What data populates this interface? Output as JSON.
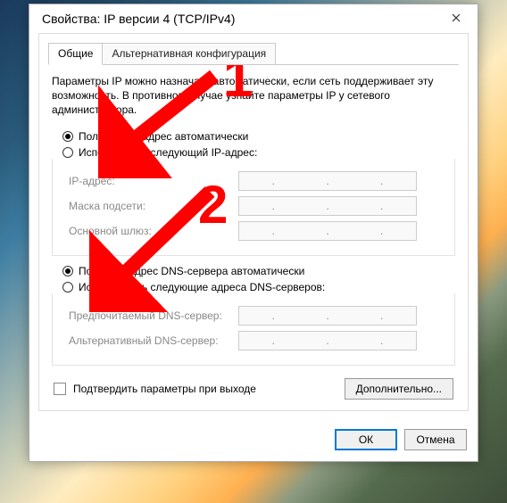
{
  "window": {
    "title": "Свойства: IP версии 4 (TCP/IPv4)"
  },
  "tabs": {
    "general": "Общие",
    "alt": "Альтернативная конфигурация"
  },
  "intro": "Параметры IP можно назначать автоматически, если сеть поддерживает эту возможность. В противном случае узнайте параметры IP у сетевого администратора.",
  "ip": {
    "auto_label": "Получить IP-адрес автоматически",
    "manual_label": "Использовать следующий IP-адрес:",
    "addr_label": "IP-адрес:",
    "mask_label": "Маска подсети:",
    "gw_label": "Основной шлюз:"
  },
  "dns": {
    "auto_label": "Получить адрес DNS-сервера автоматически",
    "manual_label": "Использовать следующие адреса DNS-серверов:",
    "pref_label": "Предпочитаемый DNS-сервер:",
    "alt_label": "Альтернативный DNS-сервер:"
  },
  "validate_label": "Подтвердить параметры при выходе",
  "buttons": {
    "advanced": "Дополнительно...",
    "ok": "ОК",
    "cancel": "Отмена"
  },
  "annotations": {
    "one": "1",
    "two": "2"
  }
}
